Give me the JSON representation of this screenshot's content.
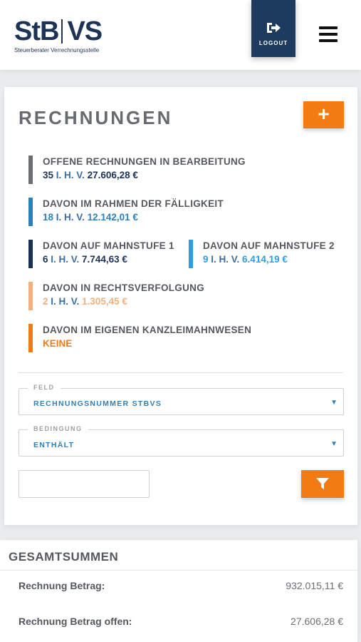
{
  "brand": {
    "logo_left": "StB",
    "logo_right": "VS",
    "tagline": "Steuerberater Verrechnungsstelle"
  },
  "header": {
    "logout_label": "LOGOUT"
  },
  "colors": {
    "brand_navy": "#1d3a5f",
    "accent_orange": "#f27b14",
    "gray_bar": "#6b6f74",
    "blue_bar": "#2f7fb8",
    "navy_bar": "#1d3356",
    "light_blue_bar": "#2d9fe0",
    "peach_bar": "#f3b07e",
    "orange_bar": "#f27b14"
  },
  "invoices": {
    "title": "RECHNUNGEN",
    "add_label": "+",
    "stats": [
      {
        "label": "OFFENE RECHNUNGEN IN BEARBEITUNG",
        "count": "35",
        "sep": " I. H. V. ",
        "amount": "27.606,28 €"
      },
      {
        "label": "DAVON IM RAHMEN DER FÄLLIGKEIT",
        "count": "18",
        "sep": " I. H. V. ",
        "amount": "12.142,01 €"
      },
      {
        "label": "DAVON AUF MAHNSTUFE 1",
        "count": "6",
        "sep": " I. H. V. ",
        "amount": "7.744,63 €"
      },
      {
        "label": "DAVON AUF MAHNSTUFE 2",
        "count": "9",
        "sep": " I. H. V. ",
        "amount": "6.414,19 €"
      },
      {
        "label": "DAVON IN RECHTSVERFOLGUNG",
        "count": "2",
        "sep": " I. H. V. ",
        "amount": "1.305,45 €"
      },
      {
        "label": "DAVON IM EIGENEN KANZLEIMAHNWESEN",
        "none": "KEINE"
      }
    ]
  },
  "filter": {
    "field_legend": "FELD",
    "field_value": "RECHNUNGSNUMMER STBVS",
    "condition_legend": "BEDINGUNG",
    "condition_value": "ENTHÄLT",
    "search_value": ""
  },
  "totals": {
    "title": "GESAMTSUMMEN",
    "rows": [
      {
        "label": "Rechnung Betrag:",
        "value": "932.015,11 €"
      },
      {
        "label": "Rechnung Betrag offen:",
        "value": "27.606,28 €"
      }
    ]
  }
}
